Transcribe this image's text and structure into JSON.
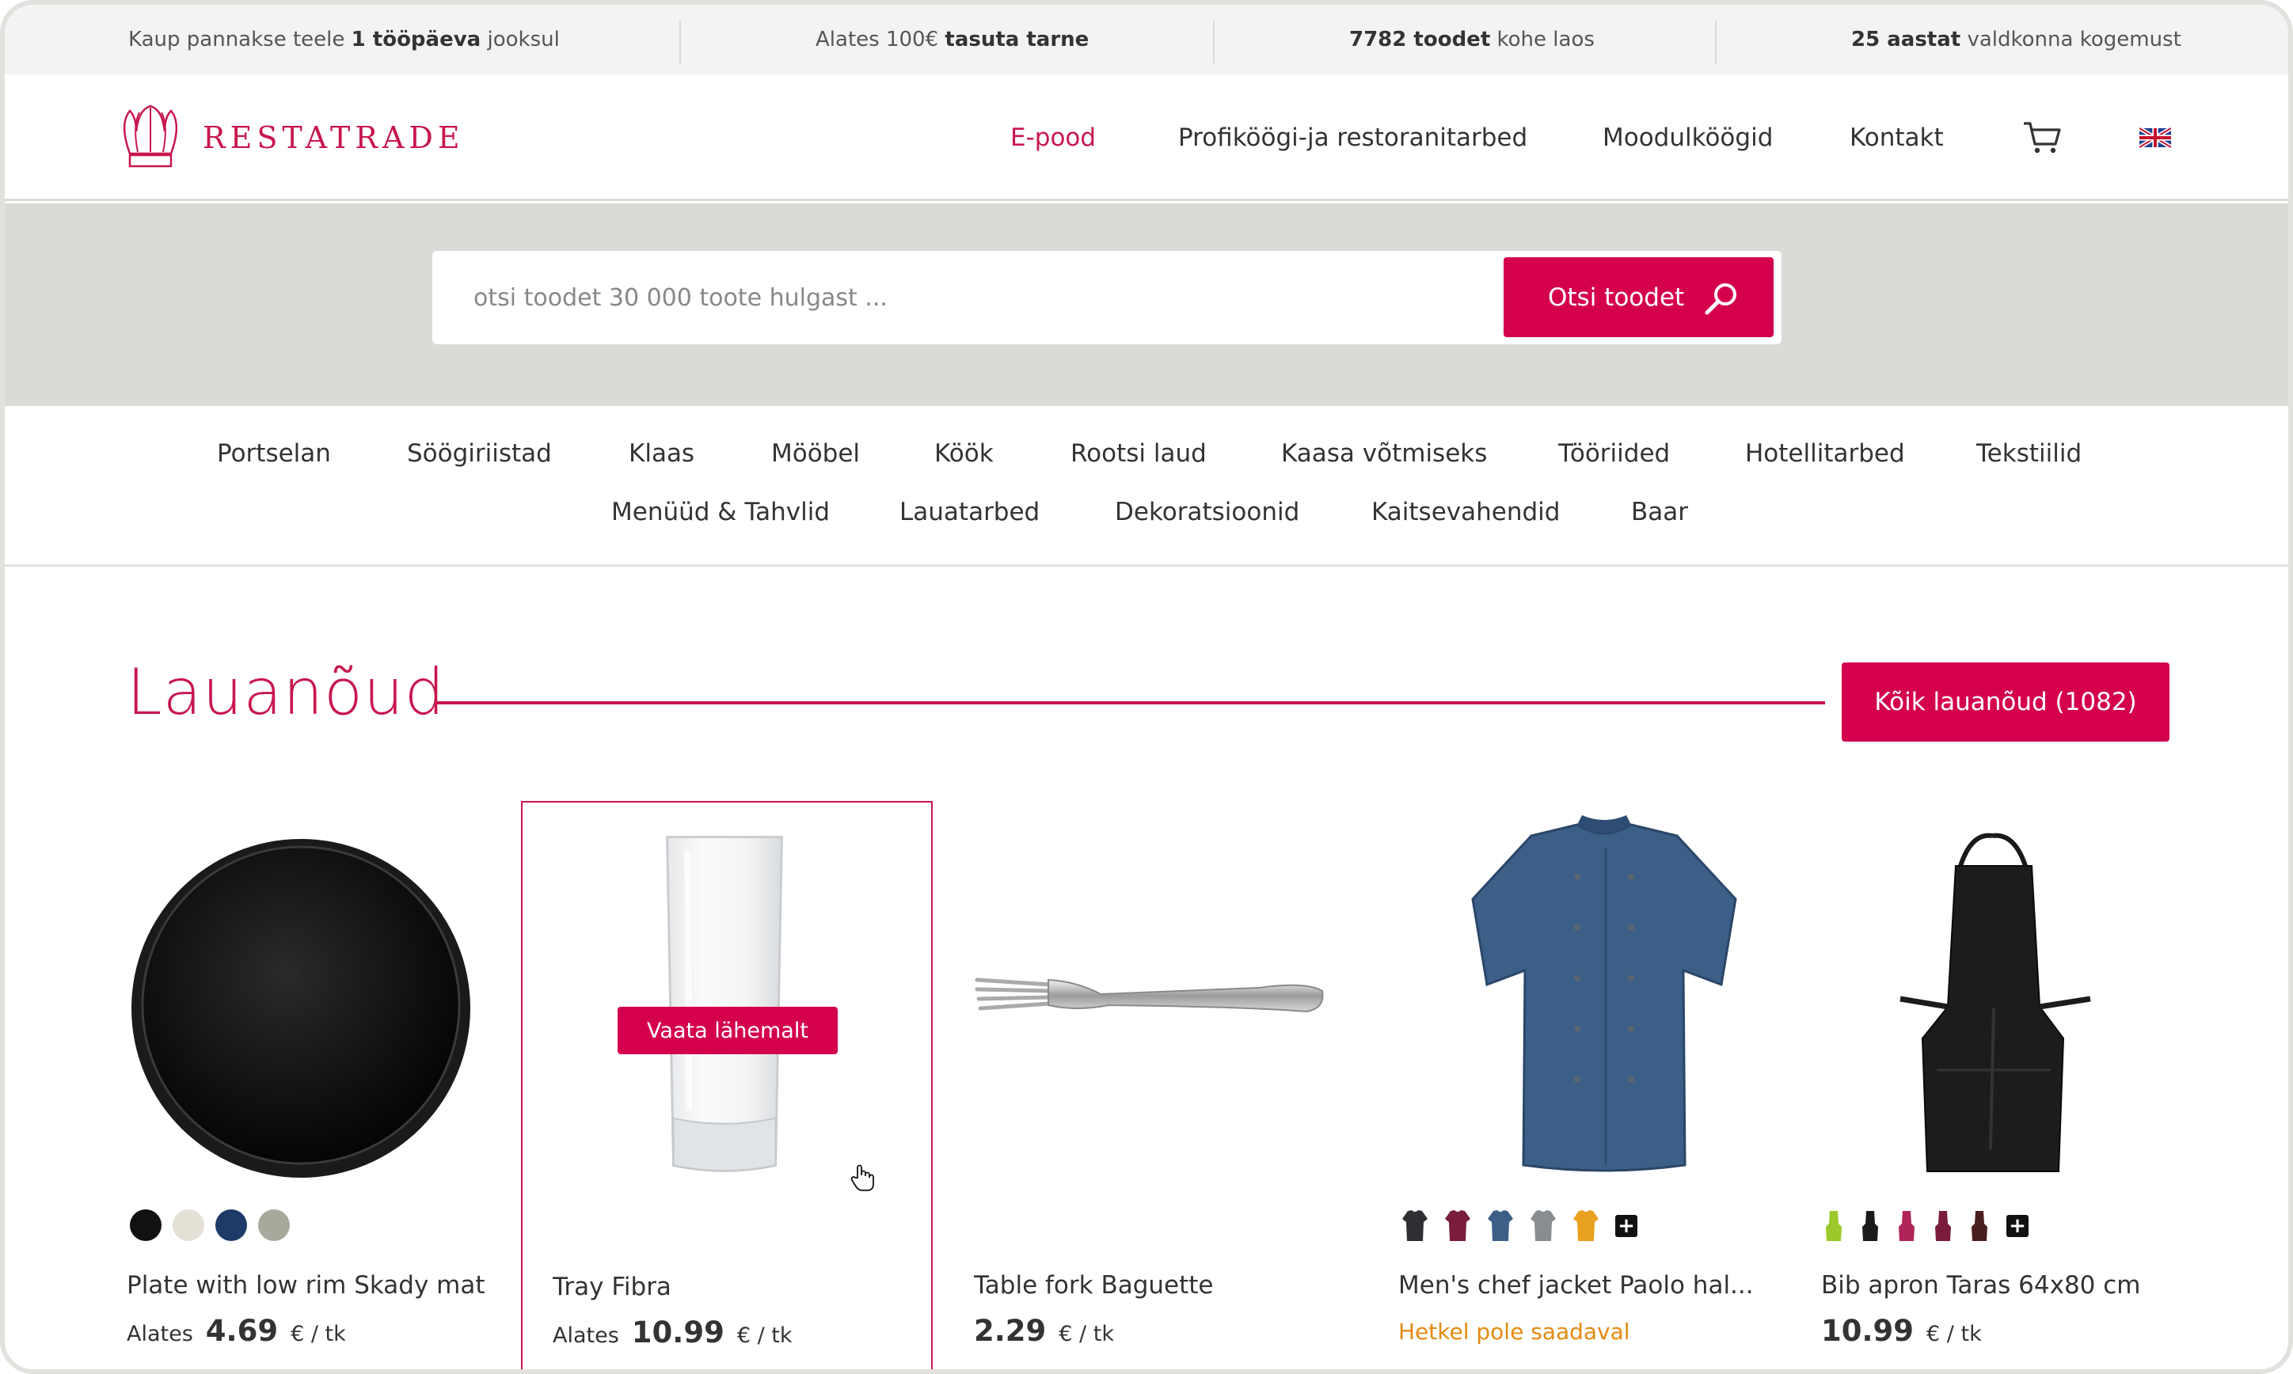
{
  "topbar": {
    "item1": {
      "pre": "Kaup pannakse teele ",
      "bold": "1 tööpäeva",
      "post": " jooksul"
    },
    "item2": {
      "pre": "Alates 100€ ",
      "bold": "tasuta tarne",
      "post": ""
    },
    "item3": {
      "pre": "",
      "bold": "7782 toodet",
      "post": " kohe laos"
    },
    "item4": {
      "pre": "",
      "bold": "25 aastat",
      "post": " valdkonna kogemust"
    }
  },
  "header": {
    "logo_text": "RESTATRADE",
    "nav": [
      "E-pood",
      "Profiköögi-ja restoranitarbed",
      "Moodulköögid",
      "Kontakt"
    ],
    "cart_icon": "cart-icon",
    "lang_icon": "uk-flag-icon"
  },
  "search": {
    "placeholder": "otsi toodet 30 000 toote hulgast ...",
    "button_label": "Otsi toodet",
    "icon": "search-icon"
  },
  "categories": {
    "row1": [
      "Portselan",
      "Söögiriistad",
      "Klaas",
      "Mööbel",
      "Köök",
      "Rootsi laud",
      "Kaasa võtmiseks",
      "Tööriided",
      "Hotellitarbed",
      "Tekstiilid"
    ],
    "row2": [
      "Menüüd & Tahvlid",
      "Lauatarbed",
      "Dekoratsioonid",
      "Kaitsevahendid",
      "Baar"
    ]
  },
  "section": {
    "title": "Lauanõud",
    "all_button": "Kõik lauanõud (1082)"
  },
  "products": [
    {
      "name": "Plate with low rim Skady mat",
      "from": "Alates",
      "price": "4.69",
      "unit": "€ / tk",
      "swatches": [
        "#111111",
        "#e4e0d6",
        "#1e3a66",
        "#a8a89c"
      ]
    },
    {
      "name": "Tray Fibra",
      "from": "Alates",
      "price": "10.99",
      "unit": "€ / tk",
      "hover_label": "Vaata lähemalt"
    },
    {
      "name": "Table fork Baguette",
      "from": "",
      "price": "2.29",
      "unit": "€ / tk"
    },
    {
      "name": "Men's chef jacket Paolo hal...",
      "status": "Hetkel pole saadaval",
      "swatches": [
        "#2f2f33",
        "#7a1c3e",
        "#3d5f86",
        "#8a8d8f",
        "#e8a21f"
      ]
    },
    {
      "name": "Bib apron Taras 64x80 cm",
      "from": "",
      "price": "10.99",
      "unit": "€ / tk",
      "swatches": [
        "#9bc82a",
        "#1a1a1a",
        "#b0245a",
        "#7a1c3e",
        "#4a1f1f"
      ]
    }
  ],
  "colors": {
    "accent": "#d4004e",
    "brand_text": "#c8174d",
    "band": "#dcdad6",
    "warning": "#e48a12"
  }
}
